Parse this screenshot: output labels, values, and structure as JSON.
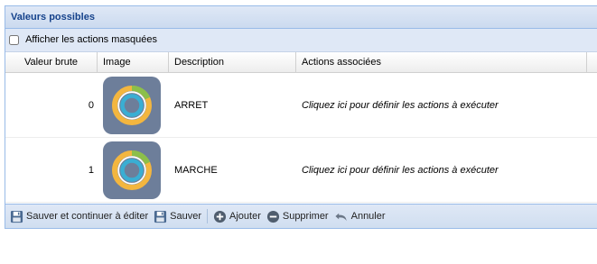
{
  "panel": {
    "title": "Valeurs possibles",
    "show_hidden_label": "Afficher les actions masquées",
    "show_hidden_checked": false
  },
  "grid": {
    "columns": [
      "Valeur brute",
      "Image",
      "Description",
      "Actions associées"
    ],
    "rows": [
      {
        "raw": "0",
        "description": "ARRET",
        "actions": "Cliquez ici pour définir les actions à exécuter"
      },
      {
        "raw": "1",
        "description": "MARCHE",
        "actions": "Cliquez ici pour définir les actions à exécuter"
      }
    ]
  },
  "toolbar": {
    "save_continue": "Sauver et continuer à éditer",
    "save": "Sauver",
    "add": "Ajouter",
    "delete": "Supprimer",
    "cancel": "Annuler"
  },
  "colors": {
    "tile_bg": "#6d7e9a",
    "ring_outer": "#f3b63f",
    "ring_accent": "#8cbf4a",
    "ring_inner": "#3aaed3"
  },
  "icons": {
    "row_image": "ring-gauge-icon",
    "save_continue": "floppy-disk-icon",
    "save": "floppy-disk-icon",
    "add": "plus-circle-icon",
    "delete": "minus-circle-icon",
    "cancel": "undo-arrow-icon"
  }
}
